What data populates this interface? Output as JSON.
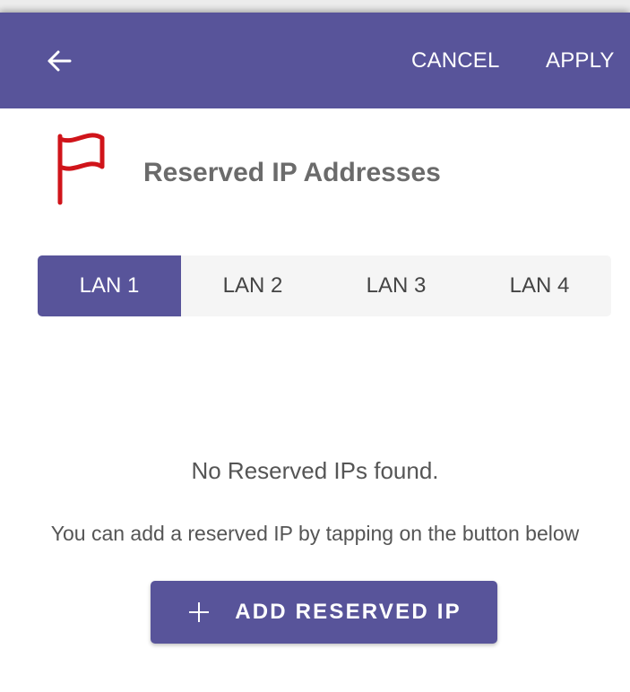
{
  "appbar": {
    "back_icon": "arrow-left-icon",
    "cancel_label": "CANCEL",
    "apply_label": "APPLY"
  },
  "section": {
    "icon": "flag-icon",
    "title": "Reserved IP Addresses"
  },
  "tabs": [
    {
      "label": "LAN 1",
      "selected": true
    },
    {
      "label": "LAN 2",
      "selected": false
    },
    {
      "label": "LAN 3",
      "selected": false
    },
    {
      "label": "LAN 4",
      "selected": false
    }
  ],
  "empty_state": {
    "title": "No Reserved IPs found.",
    "subtitle": "You can add a reserved IP by tapping on the button below"
  },
  "add_button": {
    "icon": "plus-icon",
    "label": "ADD RESERVED IP"
  },
  "colors": {
    "primary": "#58549a",
    "flag": "#d0141a",
    "title_text": "#6b6b6b",
    "body_text": "#555555"
  }
}
